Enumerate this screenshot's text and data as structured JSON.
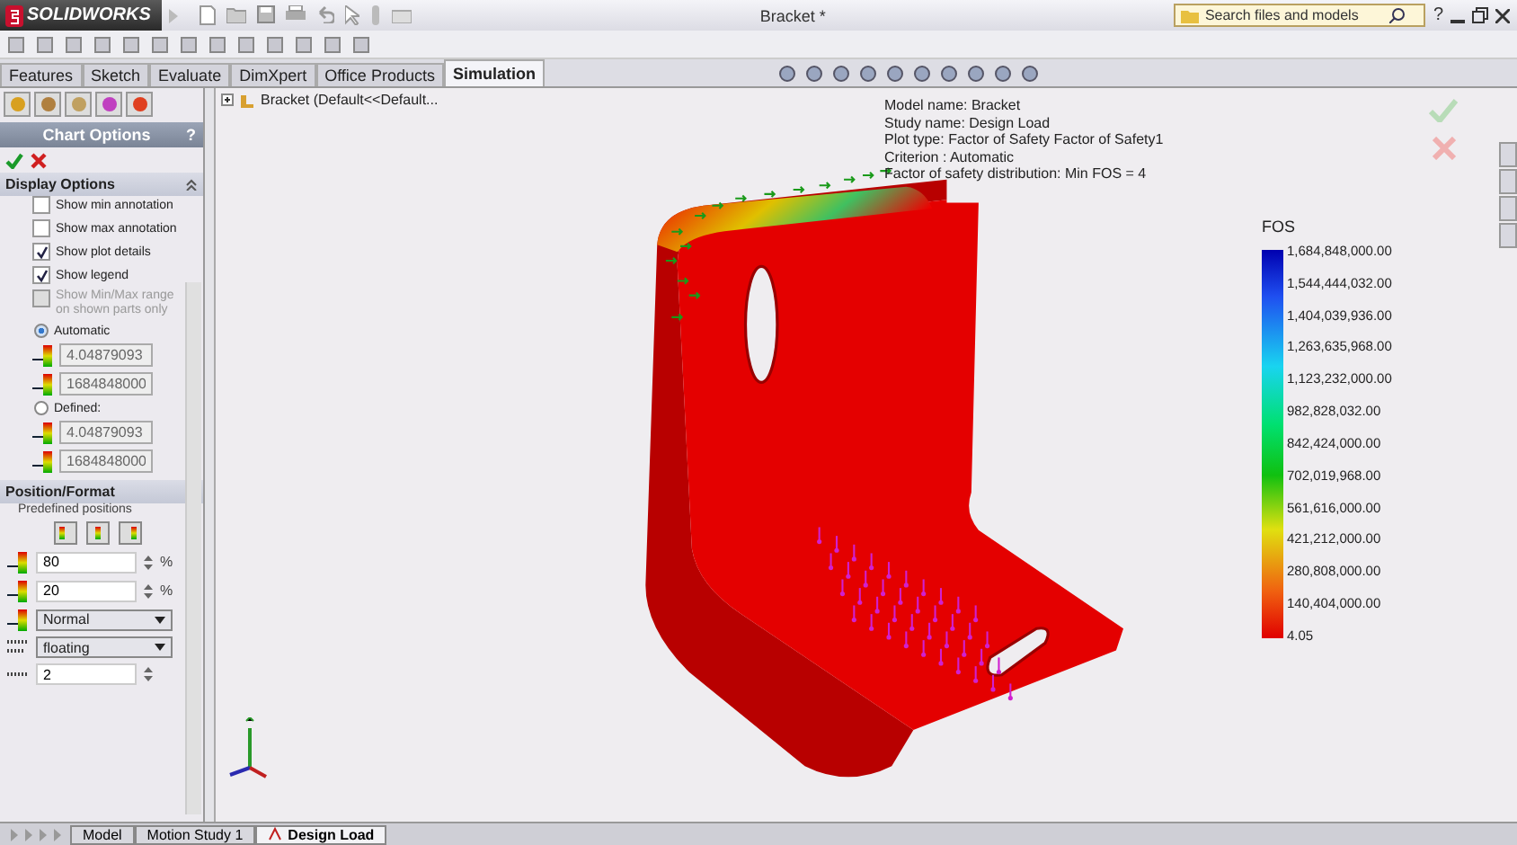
{
  "title_bar": {
    "app_name": "SOLIDWORKS",
    "document_title": "Bracket *",
    "search": {
      "placeholder": "Search files and models"
    },
    "help": "?"
  },
  "command_tabs": [
    {
      "label": "Features",
      "selected": false
    },
    {
      "label": "Sketch",
      "selected": false
    },
    {
      "label": "Evaluate",
      "selected": false
    },
    {
      "label": "DimXpert",
      "selected": false
    },
    {
      "label": "Office Products",
      "selected": false
    },
    {
      "label": "Simulation",
      "selected": true
    }
  ],
  "property_manager": {
    "title": "Chart Options",
    "help": "?",
    "sections": [
      {
        "title": "Display Options",
        "expanded": true,
        "items": [
          {
            "kind": "checkbox",
            "label": "Show min annotation",
            "checked": false,
            "disabled": false
          },
          {
            "kind": "checkbox",
            "label": "Show max annotation",
            "checked": false,
            "disabled": false
          },
          {
            "kind": "checkbox",
            "label": "Show plot details",
            "checked": true,
            "disabled": false
          },
          {
            "kind": "checkbox",
            "label": "Show legend",
            "checked": true,
            "disabled": false
          },
          {
            "kind": "checkbox",
            "label": "Show Min/Max range on shown parts only",
            "checked": false,
            "disabled": true
          },
          {
            "kind": "radio",
            "label": "Automatic",
            "selected": true
          },
          {
            "kind": "field",
            "value": "4.04879093"
          },
          {
            "kind": "field",
            "value": "1684848000"
          },
          {
            "kind": "radio",
            "label": "Defined:",
            "selected": false
          },
          {
            "kind": "field",
            "value": "4.04879093"
          },
          {
            "kind": "field",
            "value": "1684848000"
          }
        ]
      },
      {
        "title": "Position/Format",
        "expanded": true,
        "items": [
          {
            "kind": "label",
            "label": "Predefined positions"
          },
          {
            "kind": "position-buttons"
          },
          {
            "kind": "spin",
            "value": "80",
            "unit": "%"
          },
          {
            "kind": "spin",
            "value": "20",
            "unit": "%"
          },
          {
            "kind": "dropdown",
            "value": "Normal"
          },
          {
            "kind": "dropdown",
            "value": "floating"
          },
          {
            "kind": "spin",
            "value": "2"
          }
        ]
      }
    ]
  },
  "feature_tree": {
    "label": "Bracket (Default<<Default..."
  },
  "plot_details": [
    "Model name: Bracket",
    "Study name: Design Load",
    "Plot type: Factor of Safety Factor of Safety1",
    "Criterion : Automatic",
    "Factor of safety distribution: Min FOS = 4"
  ],
  "legend": {
    "title": "FOS",
    "labels": [
      "1,684,848,000.00",
      "1,544,444,032.00",
      "1,404,039,936.00",
      "1,263,635,968.00",
      "1,123,232,000.00",
      "982,828,032.00",
      "842,424,000.00",
      "702,019,968.00",
      "561,616,000.00",
      "421,212,000.00",
      "280,808,000.00",
      "140,404,000.00",
      "4.05"
    ]
  },
  "bottom_tabs": [
    {
      "label": "Model",
      "selected": false
    },
    {
      "label": "Motion Study 1",
      "selected": false
    },
    {
      "label": "Design Load",
      "selected": true
    }
  ]
}
